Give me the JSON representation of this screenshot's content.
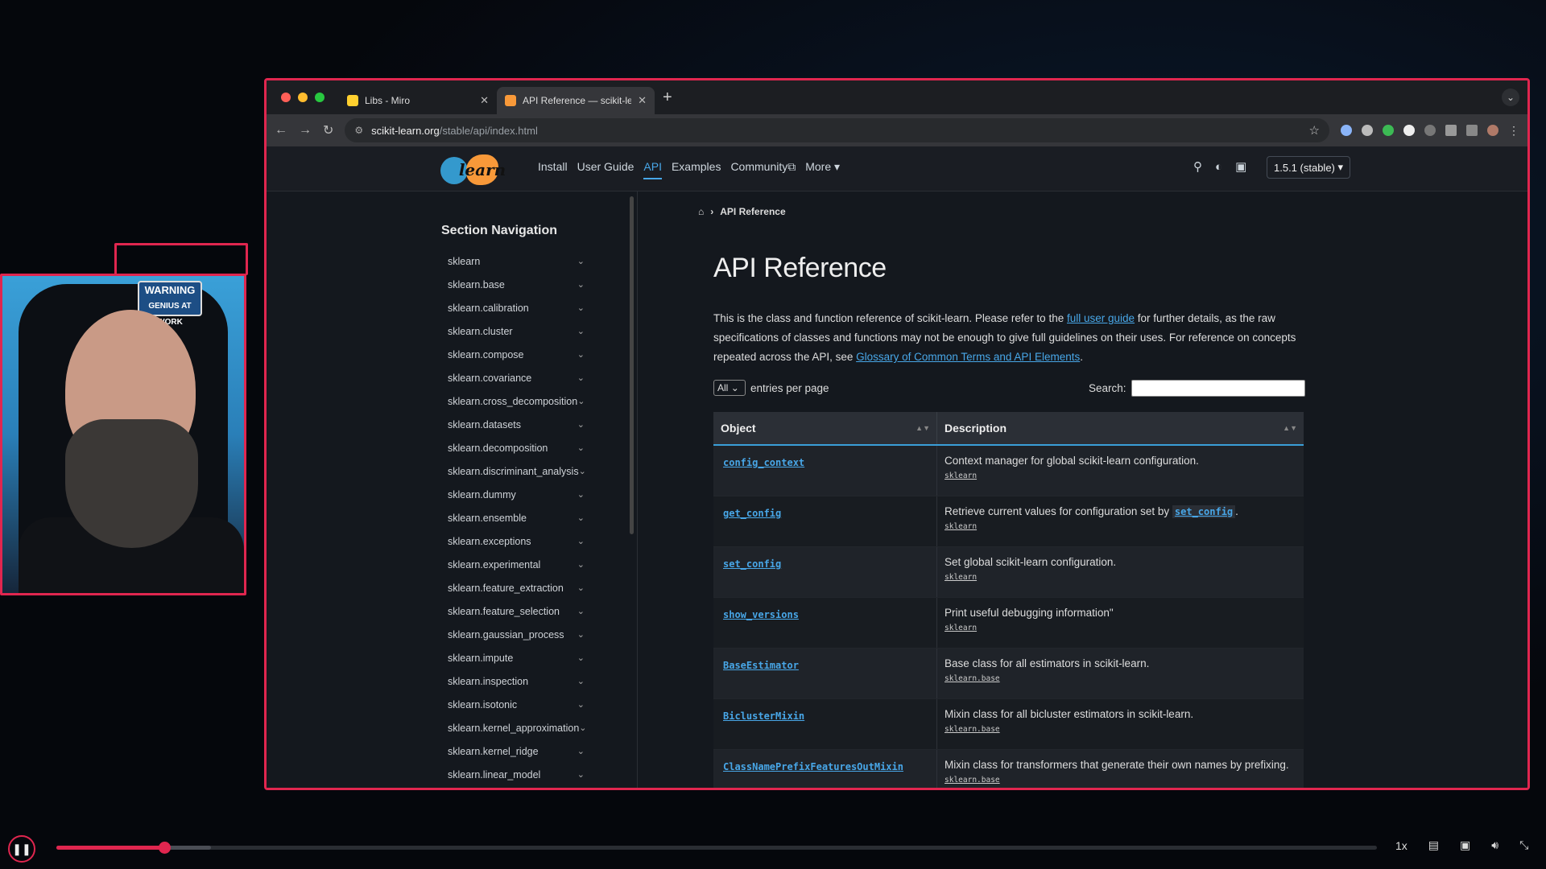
{
  "browser": {
    "tabs": [
      {
        "title": "Libs - Miro",
        "favicon_color": "#ffd02f"
      },
      {
        "title": "API Reference — scikit-learn",
        "favicon_color": "#f89939"
      }
    ],
    "url_domain": "scikit-learn.org",
    "url_path": "/stable/api/index.html"
  },
  "site": {
    "logo_text": "learn",
    "nav": [
      "Install",
      "User Guide",
      "API",
      "Examples",
      "Community",
      "More"
    ],
    "community_suffix": "⧉",
    "more_suffix": "▾",
    "version": "1.5.1 (stable)",
    "version_arrow": "▾"
  },
  "sidebar": {
    "title": "Section Navigation",
    "items": [
      "sklearn",
      "sklearn.base",
      "sklearn.calibration",
      "sklearn.cluster",
      "sklearn.compose",
      "sklearn.covariance",
      "sklearn.cross_decomposition",
      "sklearn.datasets",
      "sklearn.decomposition",
      "sklearn.discriminant_analysis",
      "sklearn.dummy",
      "sklearn.ensemble",
      "sklearn.exceptions",
      "sklearn.experimental",
      "sklearn.feature_extraction",
      "sklearn.feature_selection",
      "sklearn.gaussian_process",
      "sklearn.impute",
      "sklearn.inspection",
      "sklearn.isotonic",
      "sklearn.kernel_approximation",
      "sklearn.kernel_ridge",
      "sklearn.linear_model"
    ]
  },
  "content": {
    "breadcrumb": "API Reference",
    "title": "API Reference",
    "intro_1": "This is the class and function reference of scikit-learn. Please refer to the ",
    "intro_link1": "full user guide",
    "intro_2": " for further details, as the raw specifications of classes and functions may not be enough to give full guidelines on their uses. For reference on concepts repeated across the API, see ",
    "intro_link2": "Glossary of Common Terms and API Elements",
    "intro_3": ".",
    "length_value": "All",
    "length_label": "entries per page",
    "search_label": "Search:",
    "columns": [
      "Object",
      "Description"
    ],
    "rows": [
      {
        "obj": "config_context",
        "desc": "Context manager for global scikit-learn configuration.",
        "mod": "sklearn"
      },
      {
        "obj": "get_config",
        "desc": "Retrieve current values for configuration set by ",
        "code": "set_config",
        "after": ".",
        "mod": "sklearn"
      },
      {
        "obj": "set_config",
        "desc": "Set global scikit-learn configuration.",
        "mod": "sklearn"
      },
      {
        "obj": "show_versions",
        "desc": "Print useful debugging information\"",
        "mod": "sklearn"
      },
      {
        "obj": "BaseEstimator",
        "desc": "Base class for all estimators in scikit-learn.",
        "mod": "sklearn.base"
      },
      {
        "obj": "BiclusterMixin",
        "desc": "Mixin class for all bicluster estimators in scikit-learn.",
        "mod": "sklearn.base"
      },
      {
        "obj": "ClassNamePrefixFeaturesOutMixin",
        "desc": "Mixin class for transformers that generate their own names by prefixing.",
        "mod": "sklearn.base"
      }
    ]
  },
  "webcam": {
    "sign_line1": "WARNING",
    "sign_line2": "GENIUS AT WORK"
  },
  "player": {
    "progress": 0.082,
    "buffered": 0.117,
    "speed": "1x"
  },
  "colors": {
    "accent": "#e0264f",
    "link": "#48a7e8"
  }
}
